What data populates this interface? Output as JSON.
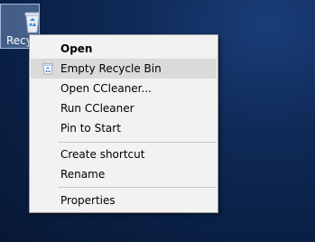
{
  "desktop": {
    "background_color": "#0f2a58",
    "icon": {
      "label": "Recyc",
      "icon_name": "recycle-bin-icon"
    }
  },
  "context_menu": {
    "items": [
      {
        "label": "Open",
        "bold": true
      },
      {
        "label": "Empty Recycle Bin",
        "icon": "recycle-bin-small-icon",
        "highlighted": true
      },
      {
        "label": "Open CCleaner..."
      },
      {
        "label": "Run CCleaner"
      },
      {
        "label": "Pin to Start"
      },
      {
        "label": "Create shortcut"
      },
      {
        "label": "Rename"
      },
      {
        "label": "Properties"
      }
    ],
    "highlight_color": "#dadada",
    "background_color": "#f2f2f2"
  }
}
